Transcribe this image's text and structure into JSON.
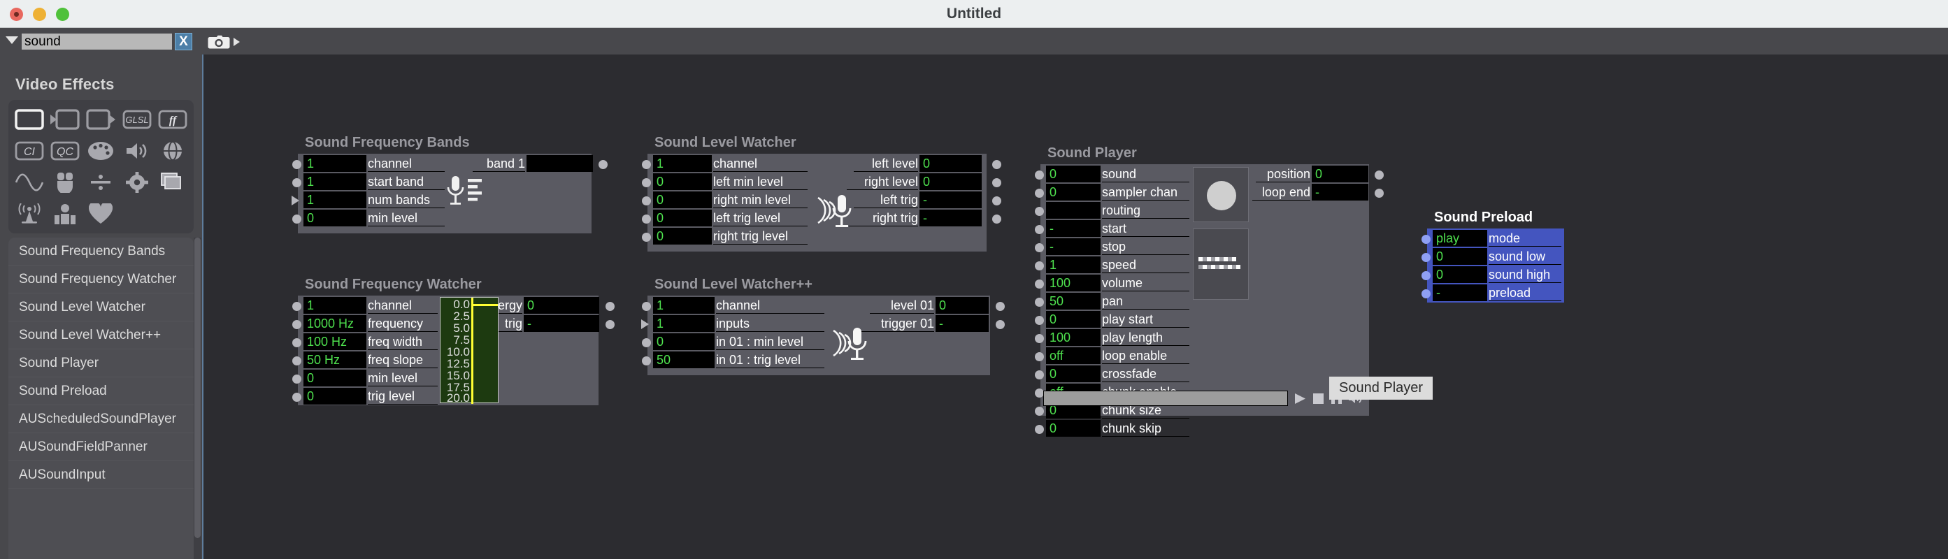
{
  "window": {
    "title": "Untitled",
    "traffic": [
      "close",
      "minimize",
      "zoom"
    ]
  },
  "toolbar": {
    "search_value": "sound",
    "search_placeholder": "",
    "clear_label": "X",
    "camera_icon": "camera-icon",
    "disclosure_icon": "triangle-down-icon"
  },
  "sidebar": {
    "title": "Video Effects",
    "icons": [
      "rectangle-icon",
      "arrow-into-box-icon",
      "arrow-out-of-box-icon",
      "gl-icon",
      "ff-icon",
      "ci-icon",
      "qc-icon",
      "palette-icon",
      "speaker-icon",
      "globe-icon",
      "sine-wave-icon",
      "mouse-icon",
      "divide-icon",
      "gear-icon",
      "layers-icon",
      "broadcast-icon",
      "person-icon",
      "heart-icon",
      "",
      ""
    ],
    "icon_labels": {
      "gl": "GLSL",
      "ff": "ff",
      "ci": "CI",
      "qc": "QC"
    },
    "items": [
      "Sound Frequency Bands",
      "Sound Frequency Watcher",
      "Sound Level Watcher",
      "Sound Level Watcher++",
      "Sound Player",
      "Sound Preload",
      "AUScheduledSoundPlayer",
      "AUSoundFieldPanner",
      "AUSoundInput"
    ]
  },
  "tooltip": {
    "text": "Sound Player"
  },
  "colors": {
    "value_green": "#4ee04e",
    "node_body": "#5a5a62",
    "node_selected": "#4455bf",
    "canvas": "#2c2c30",
    "accent_blue": "#4c7fa8"
  },
  "nodes": [
    {
      "id": "sound-frequency-bands",
      "title": "Sound Frequency Bands",
      "selected": false,
      "inputs": [
        {
          "label": "channel",
          "value": "1",
          "plug": "circle"
        },
        {
          "label": "start band",
          "value": "1",
          "plug": "circle"
        },
        {
          "label": "num bands",
          "value": "1",
          "plug": "triangle"
        },
        {
          "label": "min level",
          "value": "0",
          "plug": "circle"
        }
      ],
      "outputs": [
        {
          "label": "band 1",
          "value": "",
          "plug": "circle"
        }
      ],
      "icon": "mic-bars-icon"
    },
    {
      "id": "sound-frequency-watcher",
      "title": "Sound Frequency Watcher",
      "selected": false,
      "inputs": [
        {
          "label": "channel",
          "value": "1",
          "plug": "circle"
        },
        {
          "label": "frequency",
          "value": "1000 Hz",
          "plug": "circle"
        },
        {
          "label": "freq width",
          "value": "100 Hz",
          "plug": "circle"
        },
        {
          "label": "freq slope",
          "value": "50 Hz",
          "plug": "circle"
        },
        {
          "label": "min level",
          "value": "0",
          "plug": "circle"
        },
        {
          "label": "trig level",
          "value": "0",
          "plug": "circle"
        }
      ],
      "outputs": [
        {
          "label": "energy",
          "value": "0",
          "plug": "circle"
        },
        {
          "label": "trig",
          "value": "-",
          "plug": "circle"
        }
      ],
      "meter": {
        "ticks": [
          "0.0",
          "2.5",
          "5.0",
          "7.5",
          "10.0",
          "12.5",
          "15.0",
          "17.5",
          "20.0"
        ],
        "value": 0
      }
    },
    {
      "id": "sound-level-watcher",
      "title": "Sound Level Watcher",
      "selected": false,
      "inputs": [
        {
          "label": "channel",
          "value": "1",
          "plug": "circle"
        },
        {
          "label": "left min level",
          "value": "0",
          "plug": "circle"
        },
        {
          "label": "right min level",
          "value": "0",
          "plug": "circle"
        },
        {
          "label": "left trig level",
          "value": "0",
          "plug": "circle"
        },
        {
          "label": "right trig level",
          "value": "0",
          "plug": "circle"
        }
      ],
      "outputs": [
        {
          "label": "left level",
          "value": "0",
          "plug": "circle"
        },
        {
          "label": "right level",
          "value": "0",
          "plug": "circle"
        },
        {
          "label": "left trig",
          "value": "-",
          "plug": "circle"
        },
        {
          "label": "right trig",
          "value": "-",
          "plug": "circle"
        }
      ],
      "icon": "mic-waves-icon"
    },
    {
      "id": "sound-level-watcher-pp",
      "title": "Sound Level Watcher++",
      "selected": false,
      "inputs": [
        {
          "label": "channel",
          "value": "1",
          "plug": "circle"
        },
        {
          "label": "inputs",
          "value": "1",
          "plug": "triangle"
        },
        {
          "label": "in 01 : min level",
          "value": "0",
          "plug": "circle"
        },
        {
          "label": "in 01 : trig level",
          "value": "50",
          "plug": "circle"
        }
      ],
      "outputs": [
        {
          "label": "level 01",
          "value": "0",
          "plug": "circle"
        },
        {
          "label": "trigger 01",
          "value": "-",
          "plug": "circle"
        }
      ],
      "icon": "mic-waves-icon"
    },
    {
      "id": "sound-player",
      "title": "Sound Player",
      "selected": false,
      "inputs": [
        {
          "label": "sound",
          "value": "0",
          "plug": "circle"
        },
        {
          "label": "sampler chan",
          "value": "0",
          "plug": "circle"
        },
        {
          "label": "routing",
          "value": "",
          "plug": "circle"
        },
        {
          "label": "start",
          "value": "-",
          "plug": "circle"
        },
        {
          "label": "stop",
          "value": "-",
          "plug": "circle"
        },
        {
          "label": "speed",
          "value": "1",
          "plug": "circle"
        },
        {
          "label": "volume",
          "value": "100",
          "plug": "circle"
        },
        {
          "label": "pan",
          "value": "50",
          "plug": "circle"
        },
        {
          "label": "play start",
          "value": "0",
          "plug": "circle"
        },
        {
          "label": "play length",
          "value": "100",
          "plug": "circle"
        },
        {
          "label": "loop enable",
          "value": "off",
          "plug": "circle"
        },
        {
          "label": "crossfade",
          "value": "0",
          "plug": "circle"
        },
        {
          "label": "chunk enable",
          "value": "off",
          "plug": "circle"
        },
        {
          "label": "chunk size",
          "value": "0",
          "plug": "circle"
        },
        {
          "label": "chunk skip",
          "value": "0",
          "plug": "circle"
        }
      ],
      "outputs": [
        {
          "label": "position",
          "value": "0",
          "plug": "circle"
        },
        {
          "label": "loop end",
          "value": "-",
          "plug": "circle"
        }
      ],
      "transport": {
        "play": "play-icon",
        "stop": "stop-icon",
        "pause": "pause-icon",
        "volume": "volume-icon",
        "progress": 0
      }
    },
    {
      "id": "sound-preload",
      "title": "Sound Preload",
      "selected": true,
      "inputs": [
        {
          "label": "mode",
          "value": "play",
          "plug": "circle"
        },
        {
          "label": "sound low",
          "value": "0",
          "plug": "circle"
        },
        {
          "label": "sound high",
          "value": "0",
          "plug": "circle"
        },
        {
          "label": "preload",
          "value": "-",
          "plug": "circle"
        }
      ],
      "outputs": []
    }
  ]
}
